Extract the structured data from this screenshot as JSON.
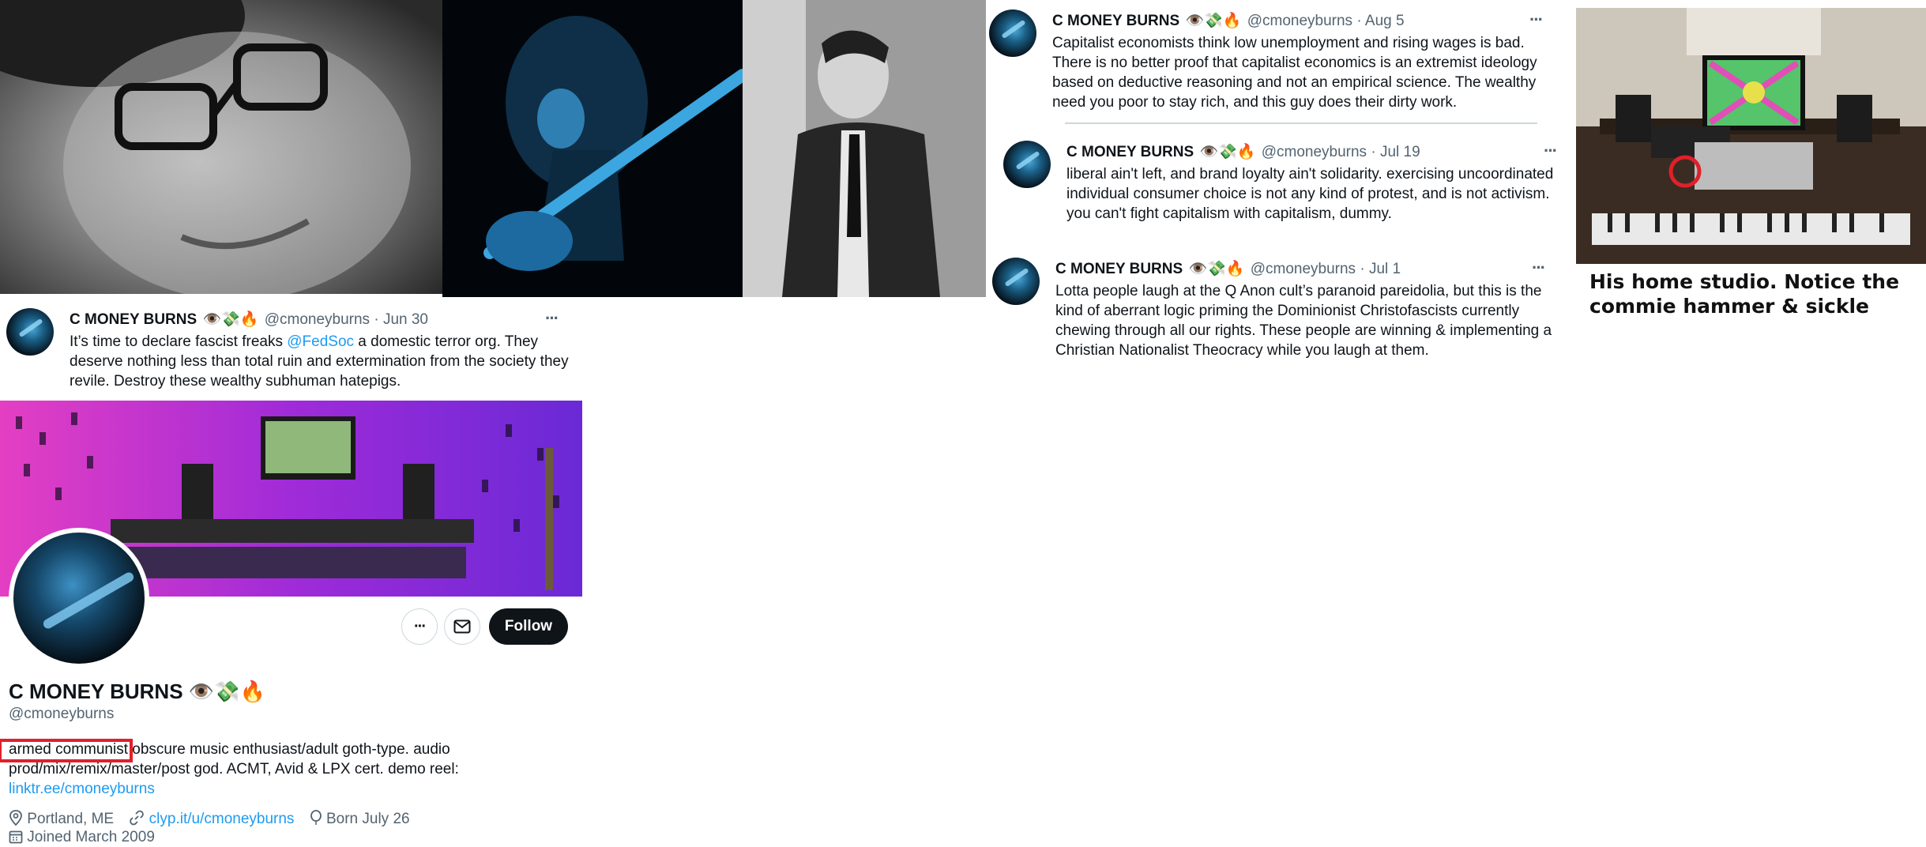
{
  "emoji": "👁️💸🔥",
  "tweets": [
    {
      "name": "C MONEY BURNS",
      "handle": "@cmoneyburns",
      "date": "Aug 5",
      "more": "···",
      "lines": [
        "Capitalist economists think low unemployment and rising wages is bad.",
        "There is no better proof that capitalist economics is an extremist ideology",
        "based on deductive reasoning and not an empirical science. The wealthy",
        "need you poor to stay rich, and this guy does their dirty work."
      ]
    },
    {
      "name": "C MONEY BURNS",
      "handle": "@cmoneyburns",
      "date": "Jul 19",
      "more": "···",
      "lines": [
        "liberal ain't left, and brand loyalty ain't solidarity. exercising uncoordinated",
        "individual consumer choice is not any kind of protest, and is not activism.",
        "you can't fight capitalism with capitalism, dummy."
      ]
    },
    {
      "name": "C MONEY BURNS",
      "handle": "@cmoneyburns",
      "date": "Jul 1",
      "more": "···",
      "lines": [
        "Lotta people laugh at the Q Anon cult’s paranoid pareidolia, but this is the",
        "kind of aberrant logic priming the Dominionist Christofascists currently",
        "chewing through all our rights. These people are winning & implementing a",
        "Christian Nationalist Theocracy while you laugh at them."
      ]
    },
    {
      "name": "C MONEY BURNS",
      "handle": "@cmoneyburns",
      "date": "Jun 30",
      "more": "···",
      "line1_before": "It’s time to declare fascist freaks ",
      "mention": "@FedSoc",
      "line1_after": " a domestic terror org. They",
      "lines": [
        "deserve nothing less than total ruin and extermination from the society they",
        "revile. Destroy these wealthy subhuman hatepigs."
      ]
    }
  ],
  "caption": {
    "line1": "His home studio.  Notice the",
    "line2": "commie hammer & sickle"
  },
  "profile": {
    "name": "C MONEY BURNS",
    "handle": "@cmoneyburns",
    "more_label": "···",
    "follow_label": "Follow",
    "bio_highlight": "armed communist",
    "bio_rest": " obscure music enthusiast/adult goth-type. audio",
    "bio_line2": "prod/mix/remix/master/post god. ACMT, Avid & LPX cert. demo reel:",
    "bio_link": "linktr.ee/cmoneyburns",
    "location": "Portland, ME",
    "website": "clyp.it/u/cmoneyburns",
    "birthday": "Born July 26",
    "joined": "Joined March 2009"
  },
  "colors": {
    "link": "#1d9bf0",
    "highlight_box": "#e0202a",
    "follow_bg": "#0f1419",
    "secondary_text": "#536471"
  },
  "icons": [
    "more-icon",
    "mail-icon",
    "location-icon",
    "link-icon",
    "balloon-icon",
    "calendar-icon"
  ]
}
